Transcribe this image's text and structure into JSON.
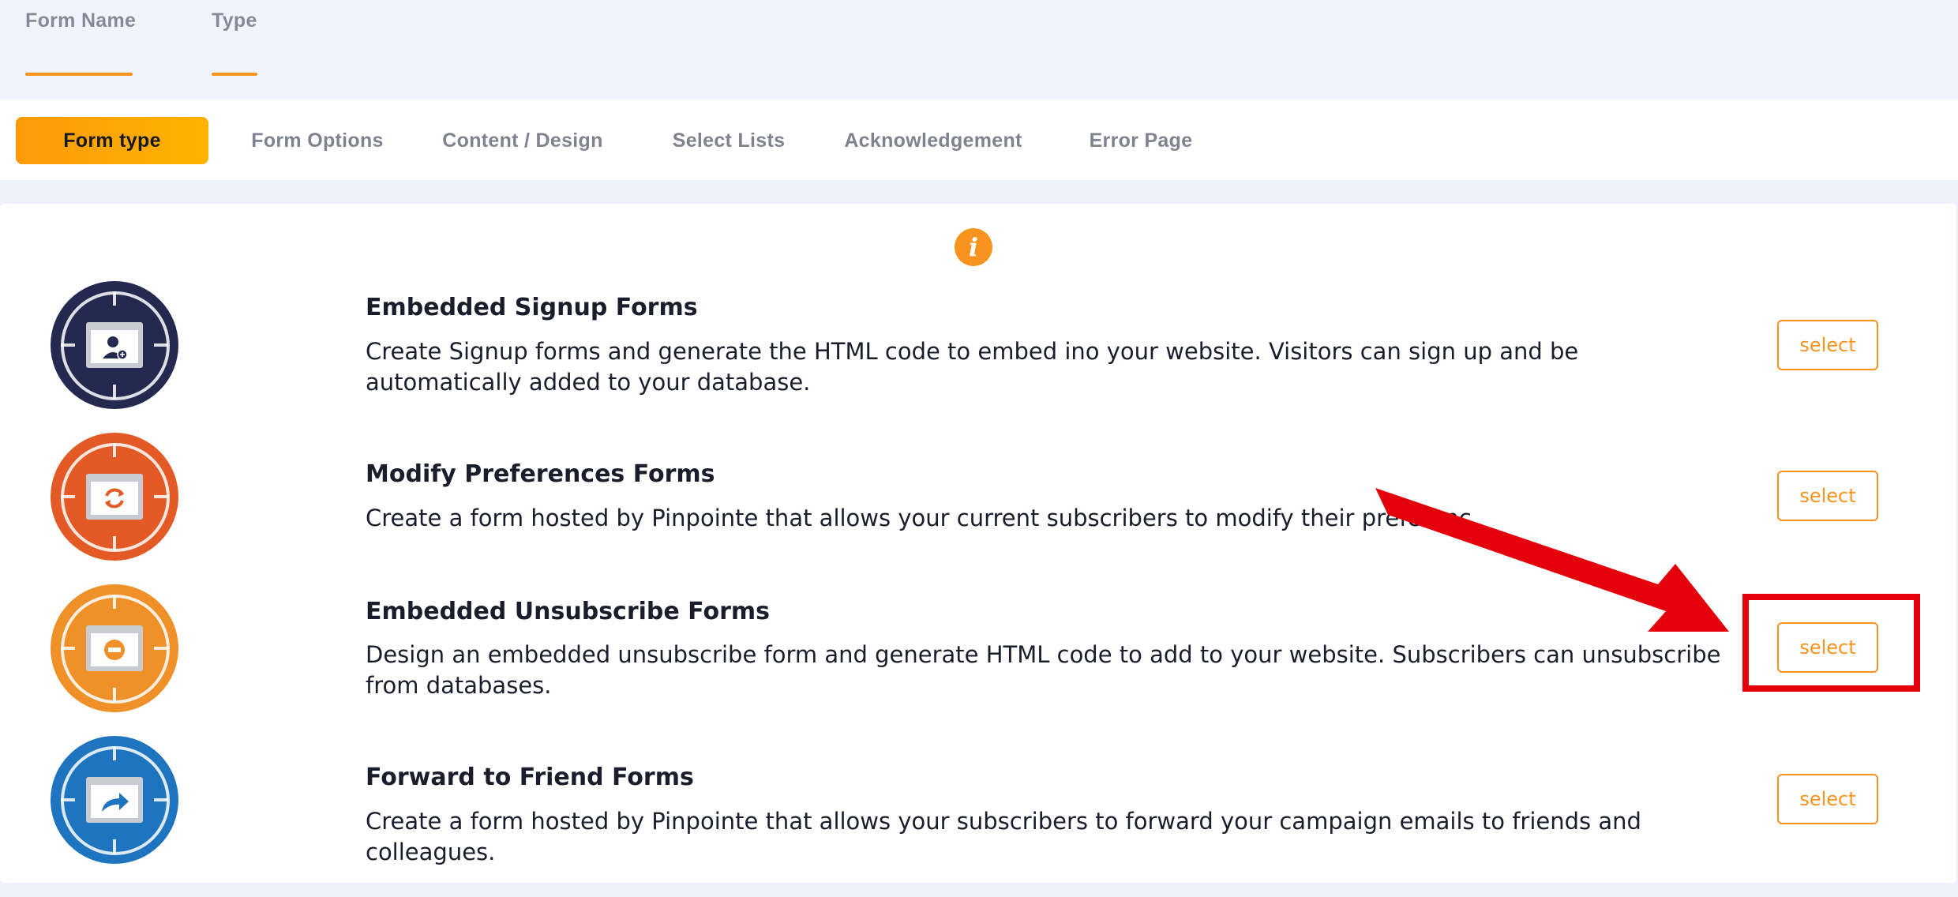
{
  "header": {
    "tabs": [
      {
        "label": "Form Name"
      },
      {
        "label": "Type"
      }
    ]
  },
  "steps": [
    {
      "label": "Form type",
      "active": true
    },
    {
      "label": "Form Options"
    },
    {
      "label": "Content / Design"
    },
    {
      "label": "Select Lists"
    },
    {
      "label": "Acknowledgement"
    },
    {
      "label": "Error Page"
    }
  ],
  "info_icon": "i",
  "form_types": [
    {
      "title": "Embedded Signup Forms",
      "description": "Create Signup forms and generate the HTML code to embed ino your website. Visitors can sign up and be automatically added to your database.",
      "icon": "add-user-screen-icon",
      "color": "#24294f",
      "button": "select"
    },
    {
      "title": "Modify Preferences Forms",
      "description": "Create a form hosted by Pinpointe that allows your current subscribers to modify their preferenc",
      "icon": "refresh-screen-icon",
      "color": "#e45a27",
      "button": "select"
    },
    {
      "title": "Embedded Unsubscribe Forms",
      "description": "Design an embedded unsubscribe form and generate HTML code to add to your website. Subscribers can unsubscribe from databases.",
      "icon": "minus-screen-icon",
      "color": "#ef9128",
      "button": "select"
    },
    {
      "title": "Forward to Friend Forms",
      "description": "Create a form hosted by Pinpointe that allows your subscribers to forward your campaign emails to friends and colleagues.",
      "icon": "forward-screen-icon",
      "color": "#1f74bf",
      "button": "select"
    }
  ],
  "colors": {
    "accent": "#f7931e",
    "annotation": "#e3000b"
  }
}
